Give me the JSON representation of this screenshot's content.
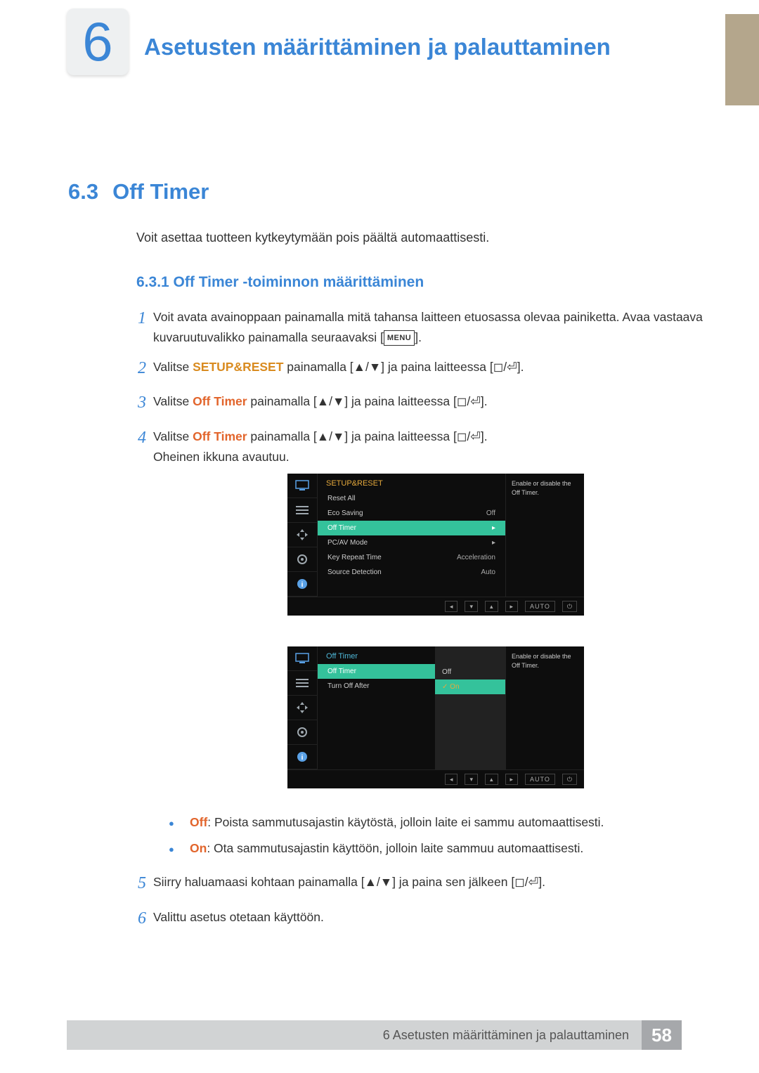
{
  "chapter": {
    "number": "6",
    "title": "Asetusten määrittäminen ja palauttaminen"
  },
  "section": {
    "number": "6.3",
    "title": "Off Timer"
  },
  "intro": "Voit asettaa tuotteen kytkeytymään pois päältä automaattisesti.",
  "subsection": "6.3.1  Off Timer -toiminnon määrittäminen",
  "menu_label": "MENU",
  "steps": {
    "s1": "Voit avata avainoppaan painamalla mitä tahansa laitteen etuosassa olevaa painiketta. Avaa vastaava kuvaruutuvalikko painamalla seuraavaksi [",
    "s1b": "].",
    "s2a": "Valitse ",
    "setup_reset": "SETUP&RESET",
    "s2b": " painamalla [▲/▼] ja paina laitteessa [◻/⏎].",
    "s3a": "Valitse ",
    "off_timer": "Off Timer",
    "s3b": " painamalla [▲/▼] ja paina laitteessa [◻/⏎].",
    "s4a": "Valitse ",
    "s4b": " painamalla [▲/▼] ja paina laitteessa [◻/⏎].",
    "s4c": "Oheinen ikkuna avautuu.",
    "s5": "Siirry haluamaasi kohtaan painamalla [▲/▼] ja paina sen jälkeen [◻/⏎].",
    "s6": "Valittu asetus otetaan käyttöön."
  },
  "bullets": {
    "off_label": "Off",
    "off_text": ": Poista sammutusajastin käytöstä, jolloin laite ei sammu automaattisesti.",
    "on_label": "On",
    "on_text": ": Ota sammutusajastin käyttöön, jolloin laite sammuu automaattisesti."
  },
  "osd1": {
    "header": "SETUP&RESET",
    "desc": "Enable or disable the Off Timer.",
    "rows": [
      {
        "label": "Reset All",
        "val": ""
      },
      {
        "label": "Eco Saving",
        "val": "Off"
      },
      {
        "label": "Off Timer",
        "val": "▸",
        "highlight": true
      },
      {
        "label": "PC/AV Mode",
        "val": "▸"
      },
      {
        "label": "Key Repeat Time",
        "val": "Acceleration"
      },
      {
        "label": "Source Detection",
        "val": "Auto"
      }
    ],
    "nav_auto": "AUTO"
  },
  "osd2": {
    "header": "Off Timer",
    "desc": "Enable or disable the Off Timer.",
    "row1": {
      "label": "Off Timer"
    },
    "row2": {
      "label": "Turn Off After"
    },
    "opts": {
      "off": "Off",
      "on": "On"
    },
    "nav_auto": "AUTO"
  },
  "footer": {
    "text": "6 Asetusten määrittäminen ja palauttaminen",
    "page": "58"
  }
}
